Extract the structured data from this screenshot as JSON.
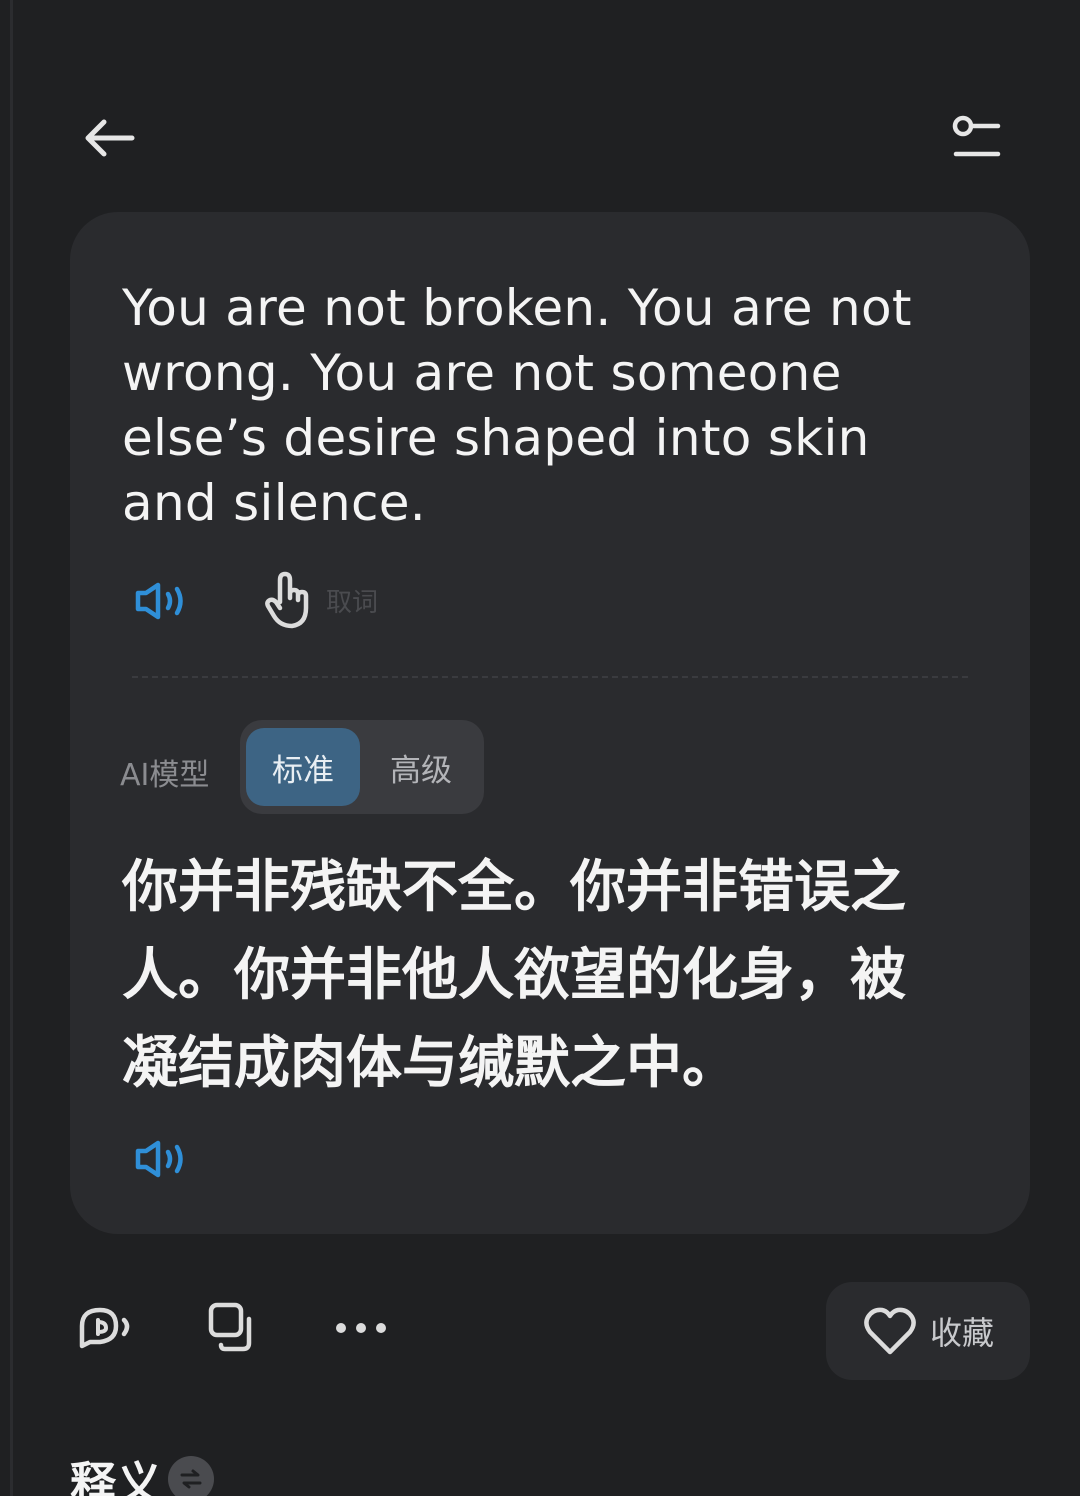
{
  "colors": {
    "background": "#1f2022",
    "card": "#2a2b2e",
    "accent": "#3d6484",
    "speaker_icon": "#2f8fd8"
  },
  "header": {
    "back_icon": "arrow-left-icon",
    "settings_icon": "sliders-icon"
  },
  "card": {
    "source_text": "You are not broken. You are not wrong. You are not someone else’s desire shaped into skin and silence.",
    "pick_word_label": "取词",
    "model": {
      "label": "AI模型",
      "options": [
        "标准",
        "高级"
      ],
      "selected": "标准"
    },
    "translation": "你并非残缺不全。你并非错误之人。你并非他人欲望的化身，被凝结成肉体与缄默之中。"
  },
  "actions": {
    "favorite_label": "收藏",
    "icons": [
      "speech-bubble-icon",
      "copy-icon",
      "more-icon",
      "heart-icon"
    ]
  },
  "section": {
    "title": "释义"
  }
}
